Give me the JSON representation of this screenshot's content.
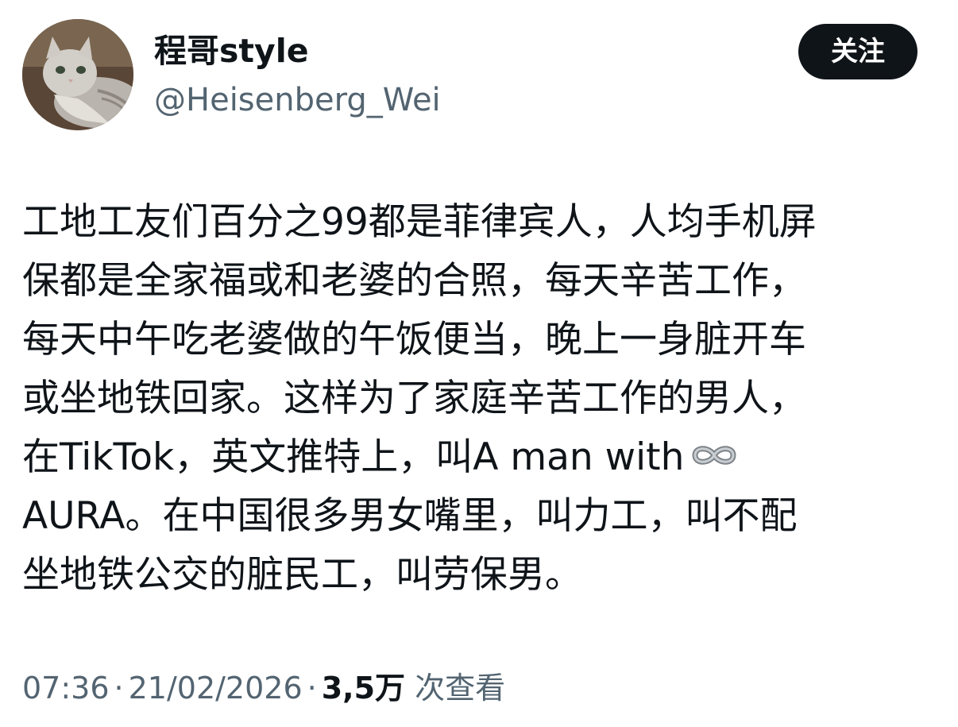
{
  "author": {
    "display_name": "程哥style",
    "handle": "@Heisenberg_Wei",
    "avatar": "cat-avatar"
  },
  "follow_button": {
    "label": "关注"
  },
  "tweet": {
    "lines": [
      "工地工友们百分之99都是菲律宾人，人均手机屏",
      "保都是全家福或和老婆的合照，每天辛苦工作，",
      "每天中午吃老婆做的午饭便当，晚上一身脏开车",
      "或坐地铁回家。这样为了家庭辛苦工作的男人，",
      "在TikTok，英文推特上，叫A man with",
      "AURA。在中国很多男女嘴里，叫力工，叫不配",
      "坐地铁公交的脏民工，叫劳保男。"
    ],
    "inline_icon": "infinity-emoji-icon"
  },
  "meta": {
    "time": "07:36",
    "date": "21/02/2026",
    "separator": "·",
    "views_count": "3,5万",
    "views_label": "次查看"
  },
  "colors": {
    "text_primary": "#0f1419",
    "text_secondary": "#536471",
    "button_bg": "#0f1419",
    "button_text": "#ffffff",
    "background": "#ffffff"
  }
}
